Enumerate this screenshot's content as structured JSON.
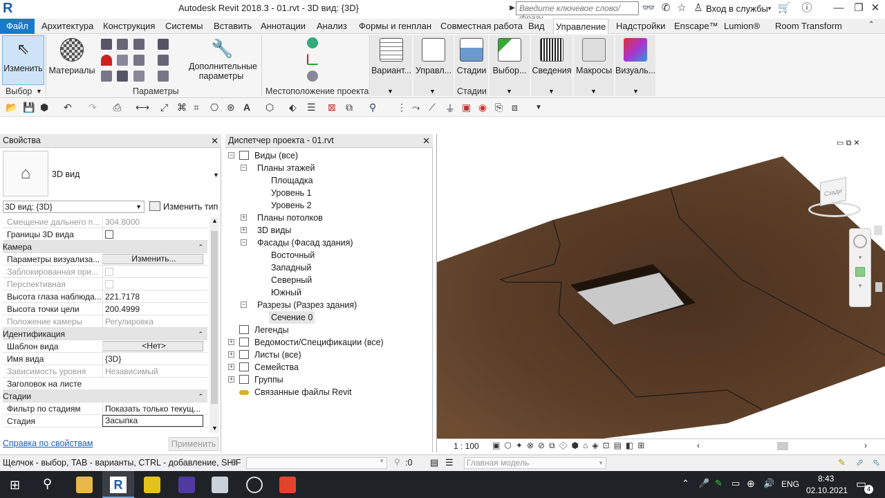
{
  "window": {
    "app_icon": "R",
    "title": "Autodesk Revit 2018.3 -    01.rvt - 3D вид: {3D}",
    "search_placeholder": "Введите ключевое слово/фразу",
    "login_label": "Вход в службы"
  },
  "menu": {
    "items": [
      "Файл",
      "Архитектура",
      "Конструкция",
      "Системы",
      "Вставить",
      "Аннотации",
      "Анализ",
      "Формы и генплан",
      "Совместная работа",
      "Вид",
      "Управление",
      "Надстройки",
      "Enscape™",
      "Lumion®",
      "Room Transform"
    ],
    "active": "Управление"
  },
  "ribbon": {
    "modify": "Изменить",
    "materials": "Материалы",
    "additional": "Дополнительные параметры",
    "variants": "Вариант...",
    "manage": "Управл...",
    "phases": "Стадии",
    "selection": "Выбор...",
    "info": "Сведения",
    "macros": "Макросы",
    "visual": "Визуаль...",
    "group_select": "Выбор",
    "group_params": "Параметры",
    "group_location": "Местоположение проекта",
    "group_phases": "Стадии"
  },
  "properties": {
    "title": "Свойства",
    "type_name": "3D вид",
    "selector": "3D вид: {3D}",
    "edit_type": "Изменить тип",
    "rows": [
      {
        "k": "Смещение дальнего п...",
        "v": "304.8000",
        "grey": true
      },
      {
        "k": "Границы 3D вида",
        "v": "",
        "check": true
      },
      {
        "section": "Камера"
      },
      {
        "k": "Параметры визуализа...",
        "v": "Изменить...",
        "button": true
      },
      {
        "k": "Заблокированная ори...",
        "v": "",
        "check": true,
        "grey": true
      },
      {
        "k": "Перспективная",
        "v": "",
        "check": true,
        "grey": true
      },
      {
        "k": "Высота глаза наблюда...",
        "v": "221.7178"
      },
      {
        "k": "Высота точки цели",
        "v": "200.4999"
      },
      {
        "k": "Положение камеры",
        "v": "Регулировка",
        "grey": true
      },
      {
        "section": "Идентификация"
      },
      {
        "k": "Шаблон вида",
        "v": "<Нет>",
        "button": true
      },
      {
        "k": "Имя вида",
        "v": "{3D}"
      },
      {
        "k": "Зависимость уровня",
        "v": "Независимый",
        "grey": true
      },
      {
        "k": "Заголовок на листе",
        "v": ""
      },
      {
        "section": "Стадии"
      },
      {
        "k": "Фильтр по стадиям",
        "v": "Показать только текущ..."
      },
      {
        "k": "Стадия",
        "v": "Засыпка",
        "boxed": true
      }
    ],
    "help_link": "Справка по свойствам",
    "apply": "Применить"
  },
  "browser": {
    "title": "Диспетчер проекта - 01.rvt",
    "nodes": [
      {
        "t": "Виды (все)",
        "lvl": 0,
        "tog": "−",
        "icon": true
      },
      {
        "t": "Планы этажей",
        "lvl": 1,
        "tog": "−"
      },
      {
        "t": "Площадка",
        "lvl": 2
      },
      {
        "t": "Уровень 1",
        "lvl": 2
      },
      {
        "t": "Уровень 2",
        "lvl": 2
      },
      {
        "t": "Планы потолков",
        "lvl": 1,
        "tog": "+"
      },
      {
        "t": "3D виды",
        "lvl": 1,
        "tog": "+"
      },
      {
        "t": "Фасады (Фасад здания)",
        "lvl": 1,
        "tog": "−"
      },
      {
        "t": "Восточный",
        "lvl": 2
      },
      {
        "t": "Западный",
        "lvl": 2
      },
      {
        "t": "Северный",
        "lvl": 2
      },
      {
        "t": "Южный",
        "lvl": 2
      },
      {
        "t": "Разрезы (Разрез здания)",
        "lvl": 1,
        "tog": "−"
      },
      {
        "t": "Сечение 0",
        "lvl": 2,
        "sel": true
      },
      {
        "t": "Легенды",
        "lvl": 0,
        "icon": true
      },
      {
        "t": "Ведомости/Спецификации (все)",
        "lvl": 0,
        "tog": "+",
        "icon": true
      },
      {
        "t": "Листы (все)",
        "lvl": 0,
        "tog": "+",
        "icon": true
      },
      {
        "t": "Семейства",
        "lvl": 0,
        "tog": "+",
        "icon": true
      },
      {
        "t": "Группы",
        "lvl": 0,
        "tog": "+",
        "icon": true
      },
      {
        "t": "Связанные файлы Revit",
        "lvl": 0,
        "icon": true,
        "link": true
      }
    ]
  },
  "viewport": {
    "scale": "1 : 100",
    "viewcube_label": "Сзади",
    "terrain_color": "#5a3d27",
    "opening_color": "#cfcfcf"
  },
  "status": {
    "hint": "Щелчок - выбор, TAB - варианты, CTRL - добавление, SHIF",
    "count": ":0",
    "model": "Главная модель"
  },
  "taskbar": {
    "lang": "ENG",
    "time": "8:43",
    "date": "02.10.2021",
    "notif": "4"
  }
}
